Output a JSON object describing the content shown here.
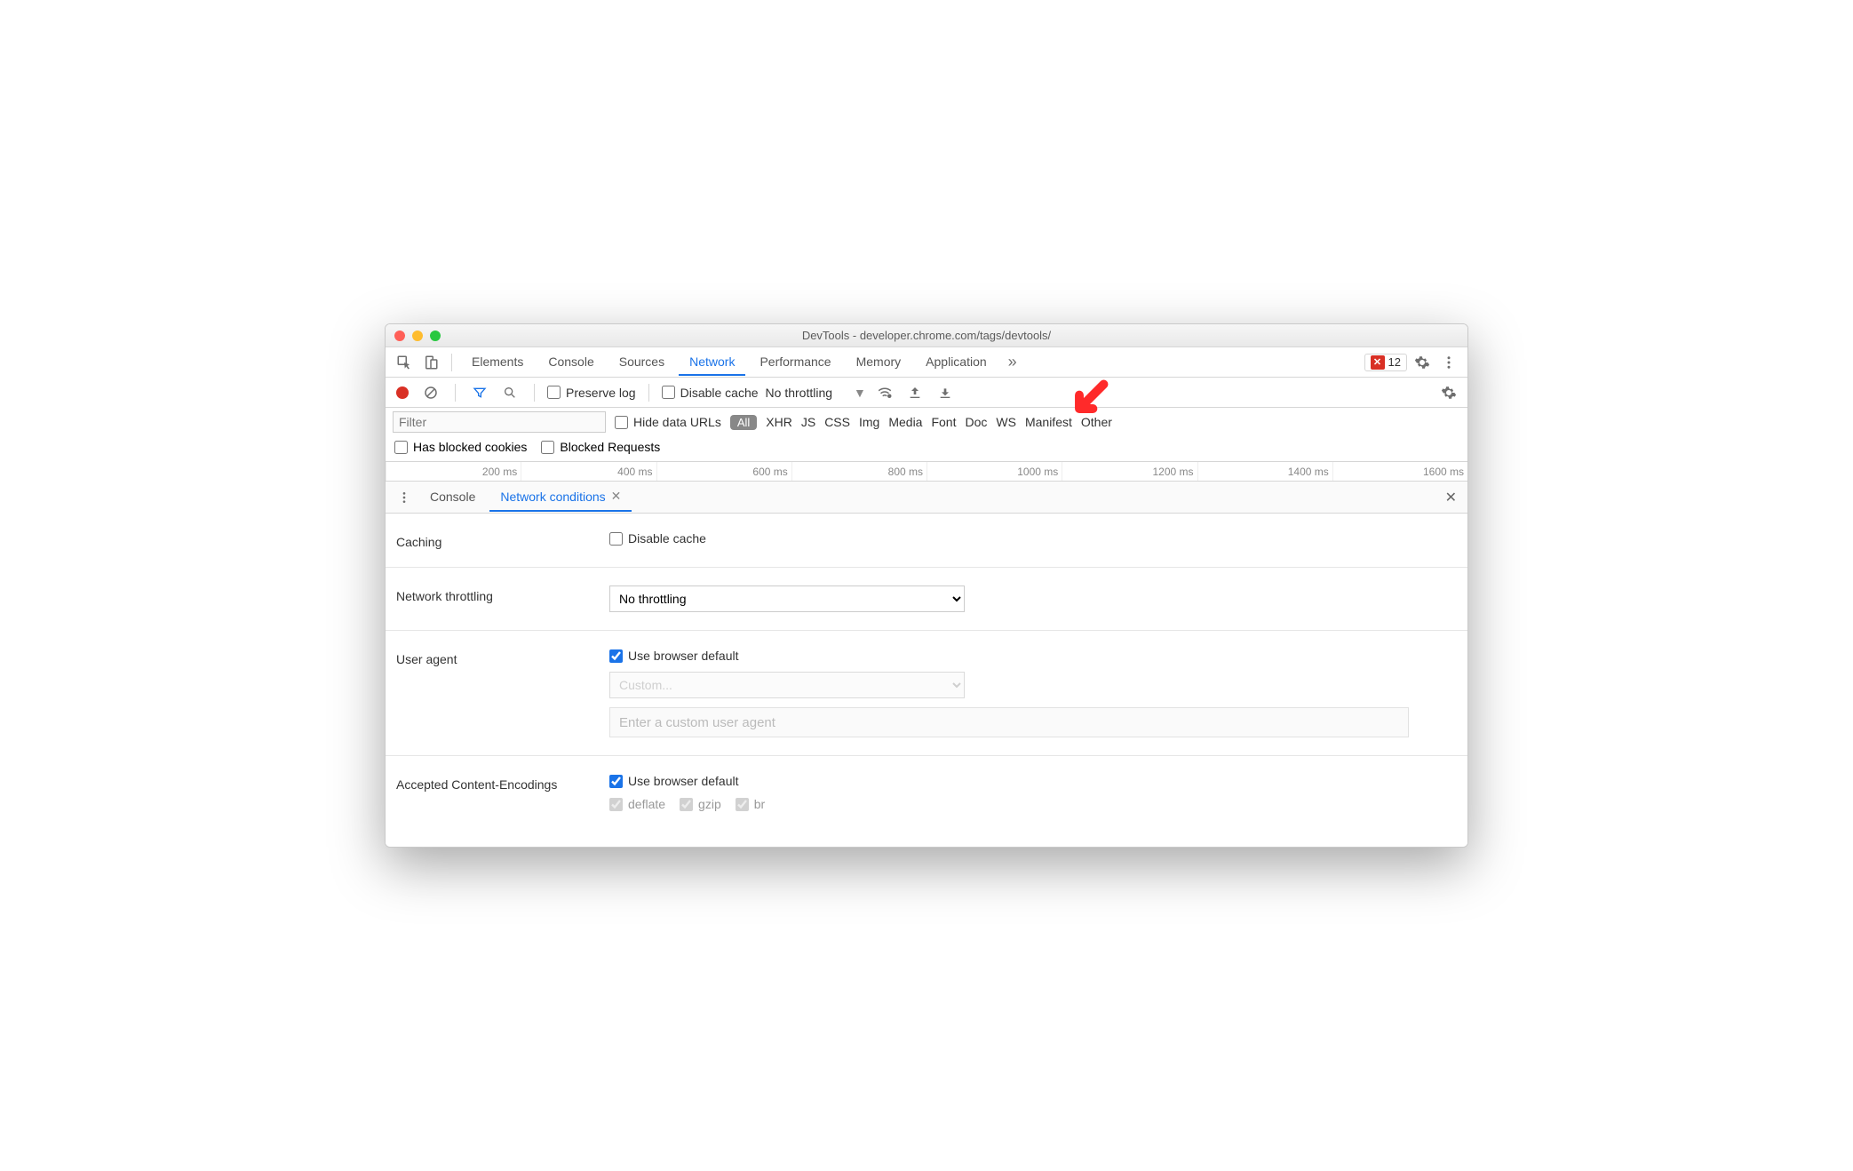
{
  "window": {
    "title": "DevTools - developer.chrome.com/tags/devtools/"
  },
  "main_tabs": {
    "items": [
      "Elements",
      "Console",
      "Sources",
      "Network",
      "Performance",
      "Memory",
      "Application"
    ],
    "active": "Network",
    "errors": "12"
  },
  "network_toolbar": {
    "preserve_log": "Preserve log",
    "disable_cache": "Disable cache",
    "throttling": "No throttling"
  },
  "filter": {
    "placeholder": "Filter",
    "hide_data_urls": "Hide data URLs",
    "all": "All",
    "types": [
      "XHR",
      "JS",
      "CSS",
      "Img",
      "Media",
      "Font",
      "Doc",
      "WS",
      "Manifest",
      "Other"
    ],
    "has_blocked_cookies": "Has blocked cookies",
    "blocked_requests": "Blocked Requests"
  },
  "timeline": {
    "ticks": [
      "200 ms",
      "400 ms",
      "600 ms",
      "800 ms",
      "1000 ms",
      "1200 ms",
      "1400 ms",
      "1600 ms"
    ]
  },
  "drawer": {
    "tabs": {
      "console": "Console",
      "network_conditions": "Network conditions"
    },
    "sections": {
      "caching": {
        "label": "Caching",
        "disable_cache": "Disable cache"
      },
      "throttling": {
        "label": "Network throttling",
        "value": "No throttling"
      },
      "user_agent": {
        "label": "User agent",
        "use_default": "Use browser default",
        "custom": "Custom...",
        "placeholder": "Enter a custom user agent"
      },
      "encodings": {
        "label": "Accepted Content-Encodings",
        "use_default": "Use browser default",
        "list": [
          "deflate",
          "gzip",
          "br"
        ]
      }
    }
  }
}
